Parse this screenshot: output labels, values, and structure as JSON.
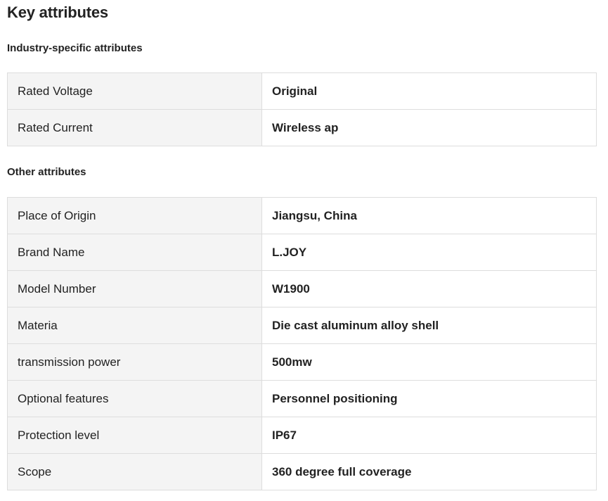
{
  "page_title": "Key attributes",
  "sections": [
    {
      "title": "Industry-specific attributes",
      "rows": [
        {
          "key": "Rated Voltage",
          "value": "Original"
        },
        {
          "key": "Rated Current",
          "value": "Wireless ap"
        }
      ]
    },
    {
      "title": "Other attributes",
      "rows": [
        {
          "key": "Place of Origin",
          "value": "Jiangsu, China"
        },
        {
          "key": "Brand Name",
          "value": "L.JOY"
        },
        {
          "key": "Model Number",
          "value": "W1900"
        },
        {
          "key": "Materia",
          "value": "Die cast aluminum alloy shell"
        },
        {
          "key": "transmission power",
          "value": "500mw"
        },
        {
          "key": "Optional features",
          "value": "Personnel positioning"
        },
        {
          "key": "Protection level",
          "value": "IP67"
        },
        {
          "key": "Scope",
          "value": "360 degree full coverage"
        }
      ]
    }
  ]
}
